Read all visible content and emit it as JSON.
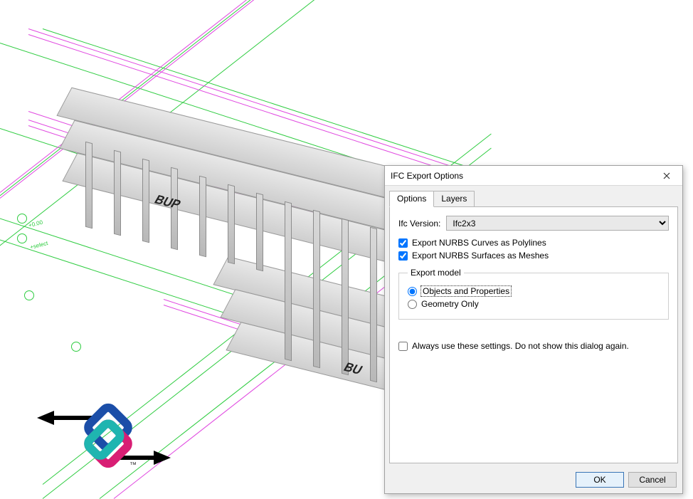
{
  "dialog": {
    "title": "IFC Export Options",
    "close_tooltip": "Close",
    "tabs": {
      "options": "Options",
      "layers": "Layers"
    },
    "version_label": "Ifc Version:",
    "version_value": "Ifc2x3",
    "chk_curves": "Export NURBS Curves as Polylines",
    "chk_surfaces": "Export NURBS Surfaces as Meshes",
    "group_label": "Export model",
    "radio_objects": "Objects and Properties",
    "radio_geometry": "Geometry Only",
    "chk_always": "Always use these settings. Do not show this dialog again.",
    "ok": "OK",
    "cancel": "Cancel"
  },
  "logo": {
    "trademark": "™"
  }
}
